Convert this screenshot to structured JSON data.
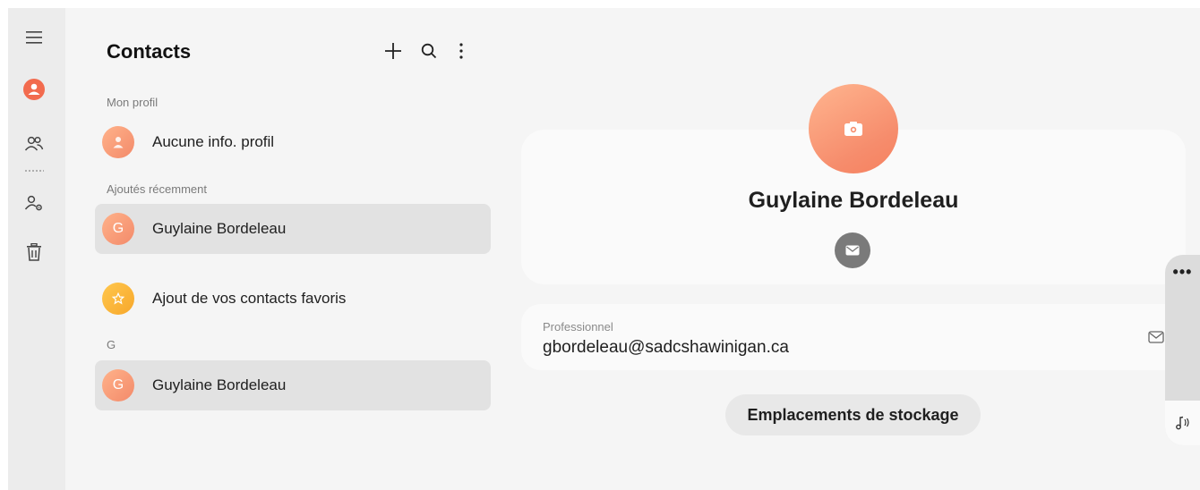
{
  "app": {
    "title": "Contacts",
    "accent_color": "#f26b4e"
  },
  "rail": {
    "items": [
      {
        "icon": "menu-icon"
      },
      {
        "icon": "profile-icon"
      },
      {
        "icon": "people-icon"
      },
      {
        "icon": "manage-contacts-icon"
      },
      {
        "icon": "trash-icon"
      }
    ]
  },
  "toolbar": {
    "add": "add-icon",
    "search": "search-icon",
    "more": "more-vertical-icon"
  },
  "list": {
    "section_profile": "Mon profil",
    "profile_row": "Aucune info. profil",
    "section_recent": "Ajoutés récemment",
    "recent_contact": {
      "initial": "G",
      "name": "Guylaine Bordeleau"
    },
    "favorites_row": "Ajout de vos contacts favoris",
    "section_g": "G",
    "g_contact": {
      "initial": "G",
      "name": "Guylaine Bordeleau"
    }
  },
  "detail": {
    "name": "Guylaine Bordeleau",
    "email_label": "Professionnel",
    "email_value": "gbordeleau@sadcshawinigan.ca",
    "storage_button": "Emplacements de stockage"
  }
}
